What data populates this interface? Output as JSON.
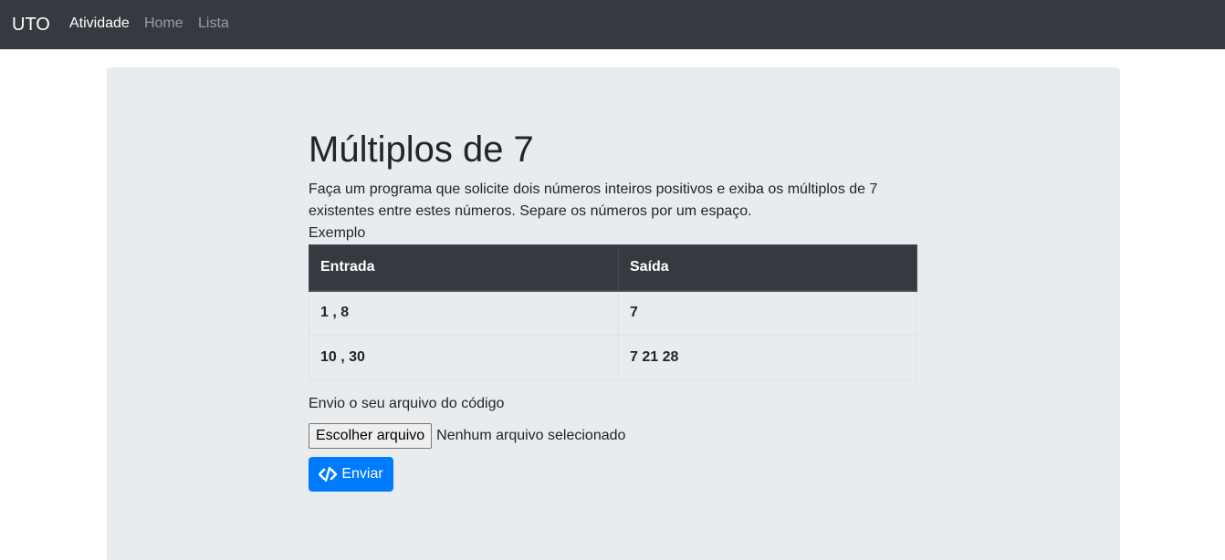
{
  "navbar": {
    "brand": "UTO",
    "links": [
      {
        "label": "Atividade",
        "active": true
      },
      {
        "label": "Home",
        "active": false
      },
      {
        "label": "Lista",
        "active": false
      }
    ]
  },
  "main": {
    "title": "Múltiplos de 7",
    "description": "Faça um programa que solicite dois números inteiros positivos e exiba os múltiplos de 7 existentes entre estes números. Separe os números por um espaço.",
    "example_label": "Exemplo",
    "table": {
      "headers": [
        "Entrada",
        "Saída"
      ],
      "rows": [
        [
          "1 , 8",
          "7"
        ],
        [
          "10 , 30",
          "7 21 28"
        ]
      ]
    },
    "upload_label": "Envio o seu arquivo do código",
    "file_button": "Escolher arquivo",
    "file_status": "Nenhum arquivo selecionado",
    "submit_label": "Enviar",
    "submit_icon": "code-icon"
  },
  "colors": {
    "navbar_bg": "#343a40",
    "jumbotron_bg": "#e9ecef",
    "primary": "#007bff"
  }
}
